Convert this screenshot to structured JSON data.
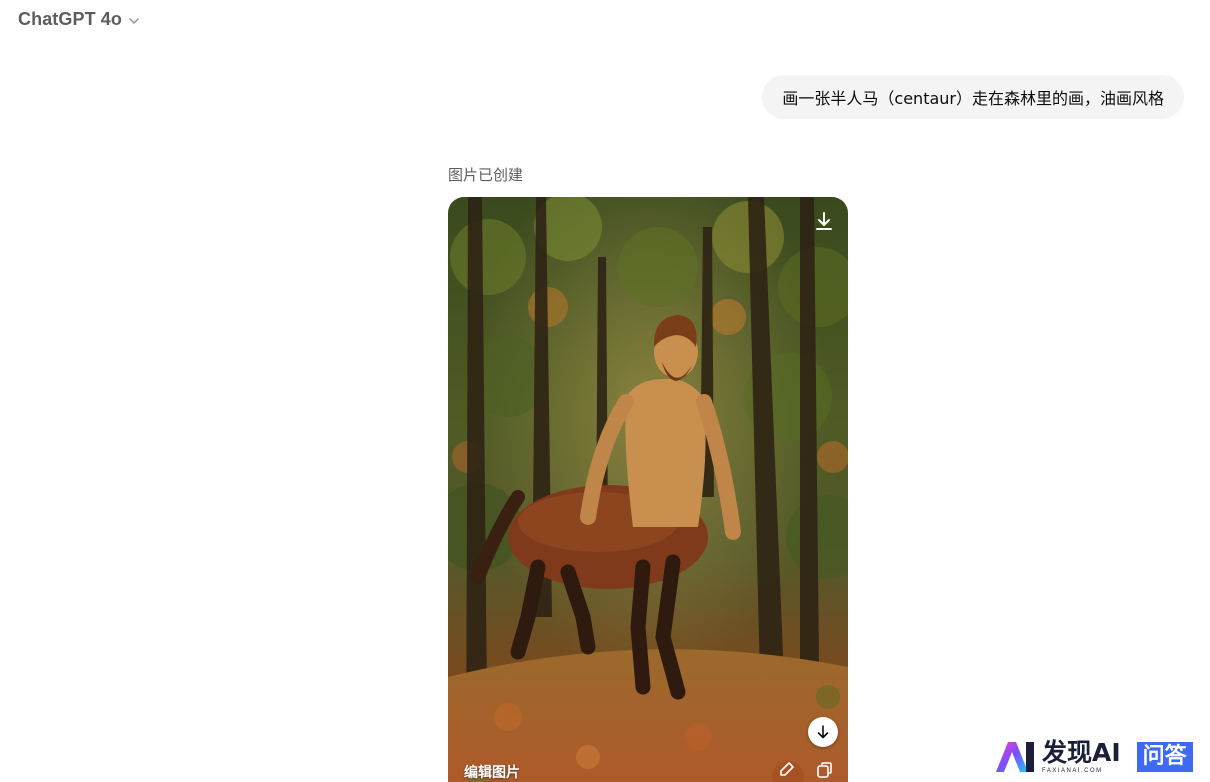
{
  "header": {
    "model_name": "ChatGPT 4o",
    "model_chevron_icon": "chevron-down-icon"
  },
  "conversation": {
    "user_message": "画一张半人马（centaur）走在森林里的画，油画风格",
    "assistant": {
      "status": "图片已创建",
      "image": {
        "subject": "centaur-in-forest-oil-painting",
        "actions": {
          "download_top_icon": "download-icon",
          "download_bottom_icon": "arrow-down-circle-icon",
          "edit_label": "编辑图片",
          "brush_icon": "brush-icon",
          "copy_icon": "copy-icon"
        }
      }
    }
  },
  "watermark": {
    "title": "发现AI",
    "subtitle": "FAXIANAI.COM",
    "badge": "问答",
    "colors": {
      "accent": "#3d6af2",
      "text": "#1c1f3a"
    }
  }
}
